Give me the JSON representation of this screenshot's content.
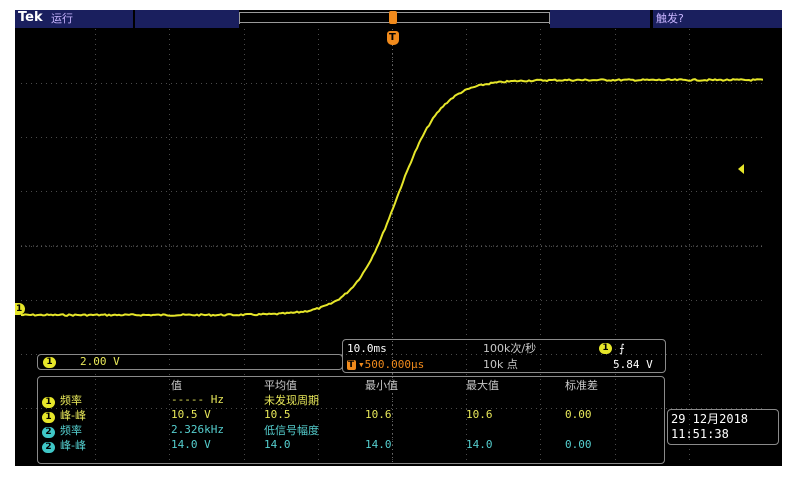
{
  "topbar": {
    "brand": "Tek",
    "run_state": "运行",
    "trigger_status": "触发?"
  },
  "markers": {
    "trigger_pos": "T",
    "ch1_ground": "1"
  },
  "channel": {
    "badge": "1",
    "scale": "2.00 V"
  },
  "horizontal": {
    "time_div": "10.0ms",
    "sample_rate": "100k次/秒",
    "trig_channel": "1",
    "trig_slope": "⨍",
    "delay": "▾500.000µs",
    "delay_prefix": "T",
    "record_length": "10k 点",
    "trig_level": "5.84 V"
  },
  "measurements": {
    "headers": [
      "值",
      "平均值",
      "最小值",
      "最大值",
      "标准差"
    ],
    "rows": [
      {
        "ch": "1",
        "name": "频率",
        "value": "----- Hz",
        "mean": "未发现周期",
        "min": "",
        "max": "",
        "std": ""
      },
      {
        "ch": "1",
        "name": "峰-峰",
        "value": "10.5 V",
        "mean": "10.5",
        "min": "10.6",
        "max": "10.6",
        "std": "0.00"
      },
      {
        "ch": "2",
        "name": "频率",
        "value": "2.326kHz",
        "mean": "低信号幅度",
        "min": "",
        "max": "",
        "std": ""
      },
      {
        "ch": "2",
        "name": "峰-峰",
        "value": "14.0 V",
        "mean": "14.0",
        "min": "14.0",
        "max": "14.0",
        "std": "0.00"
      }
    ]
  },
  "datetime": {
    "date": "29 12月2018",
    "time": "11:51:38"
  },
  "colors": {
    "ch1": "#e6e62a",
    "ch2": "#3fc7c7",
    "trigger": "#f08a1c",
    "grid": "#555555",
    "header_bar": "#1a1f5e"
  }
}
